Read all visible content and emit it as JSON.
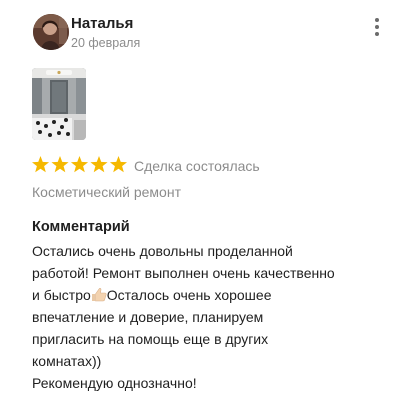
{
  "review": {
    "author": "Наталья",
    "date": "20 февраля",
    "rating": 5,
    "rating_max": 5,
    "deal_status": "Сделка состоялась",
    "category": "Косметический ремонт",
    "comment_title": "Комментарий",
    "comment_lines": [
      "Остались очень довольны проделанной",
      "работой! Ремонт выполнен очень качественно",
      "и быстро",
      "Осталось очень хорошее",
      "впечатление и доверие, планируем",
      "пригласить на помощь еще в других",
      "комнатах))",
      "Рекомендую однозначно!"
    ]
  },
  "icons": {
    "more": "kebab-menu-icon",
    "star": "star-icon",
    "emoji": "thumbs-up-emoji"
  },
  "colors": {
    "star": "#f5b800",
    "muted_text": "#8c8c8c",
    "main_text": "#1f1f1f"
  }
}
